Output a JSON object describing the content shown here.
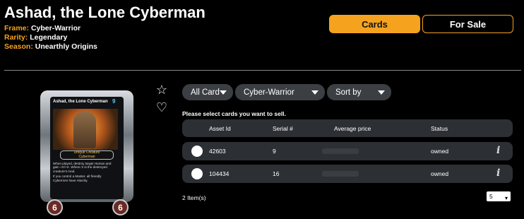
{
  "header": {
    "title": "Ashad, the Lone Cyberman",
    "frame_label": "Frame:",
    "frame_value": "Cyber-Warrior",
    "rarity_label": "Rarity:",
    "rarity_value": "Legendary",
    "season_label": "Season:",
    "season_value": "Unearthly Origins"
  },
  "tabs": {
    "cards": "Cards",
    "for_sale": "For Sale"
  },
  "card": {
    "name": "Ashad, the Lone Cyberman",
    "cost": "9",
    "type_line_1": "Unique Creature",
    "type_line_2": "Cyberman",
    "text_1": "When played, destroy target Human and gain +X/+X. Where X is the destroyed creature's mod.",
    "text_2": "If you control a Master, all friendly Cybermen have Alacrity.",
    "attack": "6",
    "health": "6"
  },
  "icons": {
    "star": "star-icon",
    "heart": "heart-icon",
    "info": "info-icon",
    "chevron": "chevron-down-icon"
  },
  "filters": {
    "all_card": "All Card",
    "frame": "Cyber-Warrior",
    "sort": "Sort by"
  },
  "table": {
    "instruction": "Please select cards you want to sell.",
    "headers": [
      "Asset Id",
      "Serial #",
      "Average price",
      "Status"
    ],
    "rows": [
      {
        "asset_id": "42603",
        "serial": "9",
        "status": "owned"
      },
      {
        "asset_id": "104434",
        "serial": "16",
        "status": "owned"
      }
    ]
  },
  "footer": {
    "items_count": "2 Item(s)",
    "per_page": "5"
  },
  "colors": {
    "accent": "#f5a31f",
    "panel": "#2c3035",
    "filter_bg": "#3b3f44",
    "background": "#000000"
  }
}
